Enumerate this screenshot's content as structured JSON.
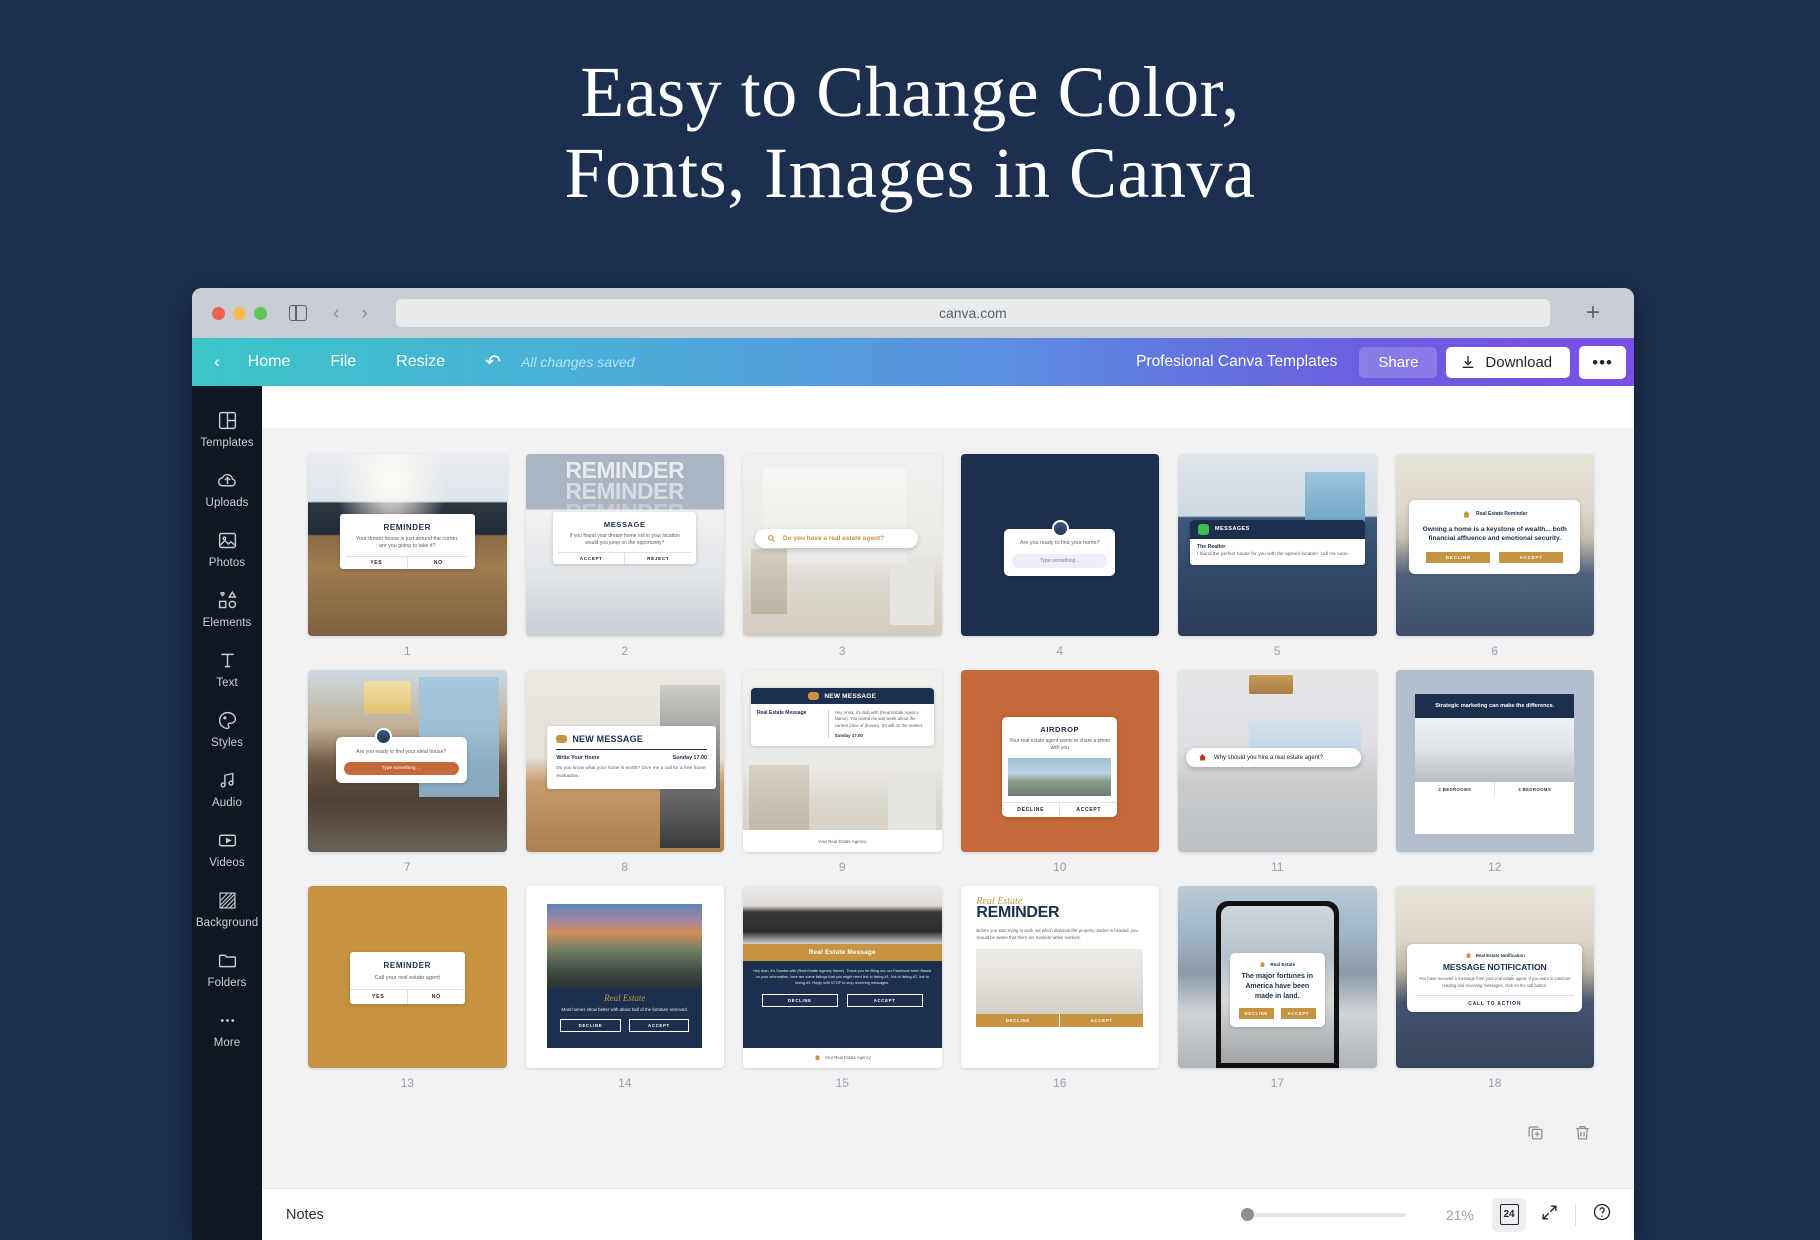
{
  "hero": {
    "line1": "Easy to Change Color,",
    "line2": "Fonts, Images in Canva"
  },
  "browser": {
    "url": "canva.com",
    "new_tab_label": "+"
  },
  "toolbar": {
    "back_label": "‹",
    "home_label": "Home",
    "file_label": "File",
    "resize_label": "Resize",
    "undo_label": "↶",
    "saved_status": "All changes saved",
    "brand_label": "Profesional Canva Templates",
    "share_label": "Share",
    "download_label": "Download",
    "more_label": "•••",
    "accent_start": "#3cc6c8",
    "accent_end": "#7a4fe6"
  },
  "sidebar": {
    "items": [
      {
        "label": "Templates",
        "icon": "templates-icon"
      },
      {
        "label": "Uploads",
        "icon": "uploads-icon"
      },
      {
        "label": "Photos",
        "icon": "photos-icon"
      },
      {
        "label": "Elements",
        "icon": "elements-icon"
      },
      {
        "label": "Text",
        "icon": "text-icon"
      },
      {
        "label": "Styles",
        "icon": "styles-icon"
      },
      {
        "label": "Audio",
        "icon": "audio-icon"
      },
      {
        "label": "Videos",
        "icon": "videos-icon"
      },
      {
        "label": "Background",
        "icon": "background-icon"
      },
      {
        "label": "Folders",
        "icon": "folders-icon"
      },
      {
        "label": "More",
        "icon": "more-icon"
      }
    ]
  },
  "footer": {
    "notes_label": "Notes",
    "zoom_percent": "21%",
    "page_count": "24",
    "expand_label": "expand-icon",
    "help_label": "?"
  },
  "page_tools": {
    "duplicate": "duplicate-page-icon",
    "delete": "delete-page-icon"
  },
  "slides": [
    {
      "num": "1",
      "style": "img-livingroom",
      "card": {
        "title": "REMINDER",
        "body": "Your dream house is just around the corner, are you going to take it?",
        "buttons": [
          "YES",
          "NO"
        ]
      }
    },
    {
      "num": "2",
      "style": "img-stairs",
      "ghost": [
        "REMINDER",
        "REMINDER",
        "REMINDER"
      ],
      "card": {
        "title": "MESSAGE",
        "body": "If you found your dream home not in your location would you jump on the opportunity?",
        "buttons": [
          "ACCEPT",
          "REJECT"
        ]
      }
    },
    {
      "num": "3",
      "style": "img-dining",
      "pill": {
        "icon": "magnifier-icon",
        "text": "Do you have a real estate agent?"
      }
    },
    {
      "num": "4",
      "style": "img-navy",
      "card": {
        "avatar": "agent-avatar",
        "body": "Are you ready to find your home?",
        "input_placeholder": "Type something..."
      }
    },
    {
      "num": "5",
      "style": "img-blue-lounge",
      "card": {
        "header": "MESSAGES",
        "sender": "The Realtor",
        "body": "I found the perfect house for you with the agreed location, call me soon."
      }
    },
    {
      "num": "6",
      "style": "img-chandelier",
      "card": {
        "eyebrow": "Real Estate Reminder",
        "body": "Owning a home is a keystone of wealth... both financial affluence and emotional security.",
        "buttons": [
          "DECLINE",
          "ACCEPT"
        ]
      }
    },
    {
      "num": "7",
      "style": "img-diningwarm",
      "card": {
        "avatar": "agent-avatar",
        "body": "Are you ready to find your ideal house?",
        "input_placeholder": "Type something ..."
      }
    },
    {
      "num": "8",
      "style": "img-kitchen",
      "card": {
        "header": "NEW MESSAGE",
        "subject": "Write Your Home",
        "time": "Sunday 17.00",
        "body": "Do you know what your home is worth? Give me a call for a free home evaluation."
      }
    },
    {
      "num": "9",
      "style": "img-dining",
      "card": {
        "header": "NEW MESSAGE",
        "label": "Real Estate Message",
        "body": "Hey Anna, it's Bob with (Real Estate Agency Name). You texted me last week about the current price of (house). It's still on the market.",
        "time": "Sunday 17.00"
      },
      "footer_text": "Your Real Estate Agency"
    },
    {
      "num": "10",
      "style": "img-orange",
      "card": {
        "title": "AIRDROP",
        "body": "Your real estate agent wants to share a photo with you",
        "buttons": [
          "DECLINE",
          "ACCEPT"
        ]
      }
    },
    {
      "num": "11",
      "style": "img-bedroom-grey",
      "pill": {
        "icon": "home-icon",
        "text": "Why should you hire a real estate agent?"
      }
    },
    {
      "num": "12",
      "style": "img-lightblue",
      "card": {
        "header": "Strategic marketing can make the difference.",
        "buttons": [
          "2 BEDROOMS",
          "3 BEDROOMS"
        ]
      }
    },
    {
      "num": "13",
      "style": "img-gold",
      "card": {
        "title": "REMINDER",
        "body": "Call your real estate agent",
        "buttons": [
          "YES",
          "NO"
        ]
      }
    },
    {
      "num": "14",
      "style": "img-house-night",
      "card": {
        "script": "Real Estate",
        "body": "Most homes show better with about half of the furniture removed.",
        "buttons": [
          "DECLINE",
          "ACCEPT"
        ]
      }
    },
    {
      "num": "15",
      "style": "img-dark-kitchen",
      "card": {
        "banner": "Real Estate Message",
        "body": "Hey Alan, it's Sandra with (Real Estate Agency Name). Thank you for filling out our Facebook form! Based on your information, here are some listings that you might need link to listing #1, link to listing #2, link to listing #3. Reply with STOP to stop receiving messages.",
        "buttons": [
          "DECLINE",
          "ACCEPT"
        ]
      },
      "footer_text": "Your Real Estate Agency"
    },
    {
      "num": "16",
      "style": "img-white",
      "card": {
        "script": "Real Estate",
        "title": "REMINDER",
        "body": "Before you start trying to work out which direction the property market is headed, you should be aware that there are markets within markets.",
        "buttons": [
          "DECLINE",
          "ACCEPT"
        ]
      }
    },
    {
      "num": "17",
      "style": "img-city",
      "card": {
        "eyebrow": "Real Estate",
        "body": "The major fortunes in America have been made in land.",
        "buttons": [
          "DECLINE",
          "ACCEPT"
        ]
      }
    },
    {
      "num": "18",
      "style": "img-diningnavy",
      "card": {
        "eyebrow": "Real Estate Notification",
        "title": "MESSAGE NOTIFICATION",
        "body": "You have received a message from your real estate agent. If you want to continue reading and receiving messages, click on the call button.",
        "buttons": [
          "CALL TO ACTION"
        ]
      }
    }
  ]
}
